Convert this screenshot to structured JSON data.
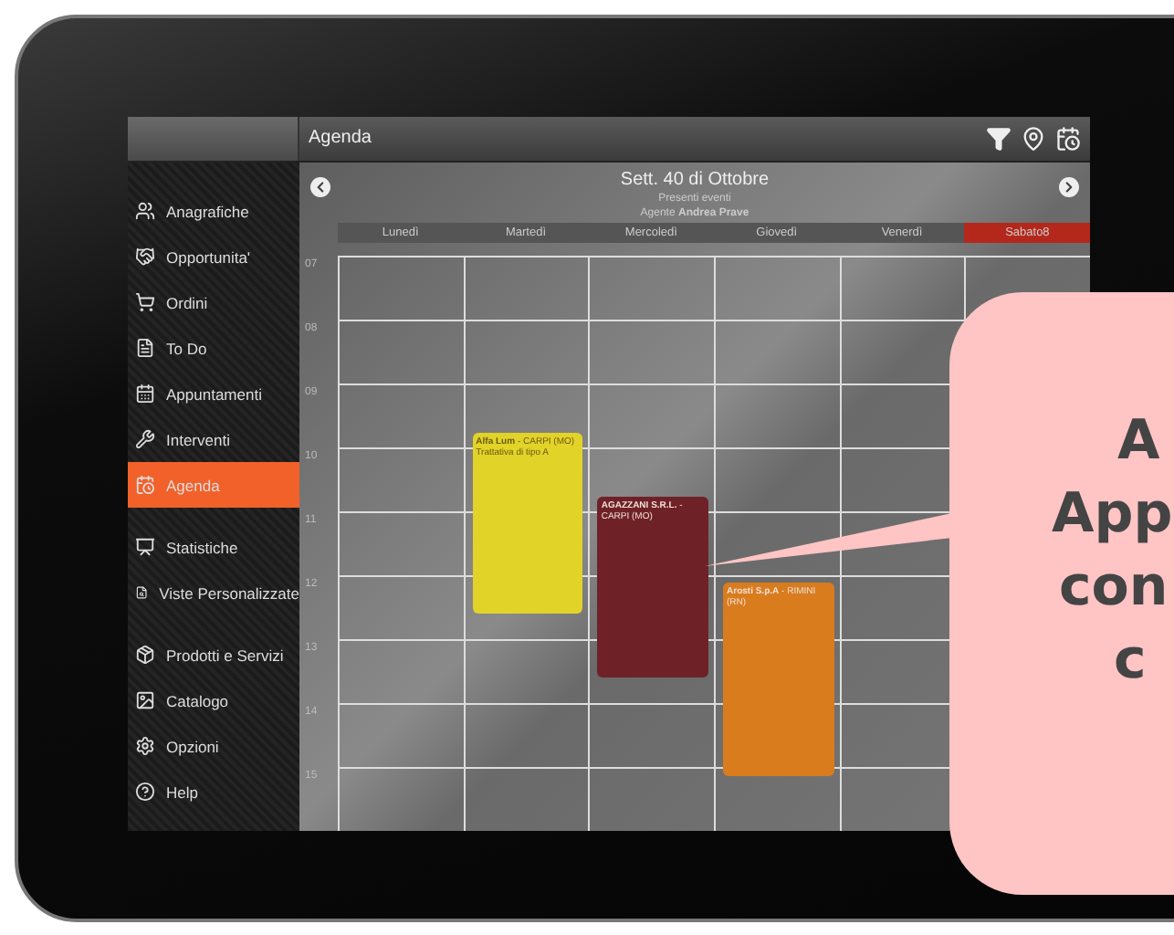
{
  "header": {
    "title": "Agenda"
  },
  "sidebar": {
    "groups": [
      [
        {
          "label": "Anagrafiche",
          "kind": "people",
          "selected": false
        },
        {
          "label": "Opportunita'",
          "kind": "handshake",
          "selected": false
        },
        {
          "label": "Ordini",
          "kind": "cart",
          "selected": false
        },
        {
          "label": "To Do",
          "kind": "todo",
          "selected": false
        },
        {
          "label": "Appuntamenti",
          "kind": "calendar",
          "selected": false
        },
        {
          "label": "Interventi",
          "kind": "tools",
          "selected": false
        },
        {
          "label": "Agenda",
          "kind": "agenda",
          "selected": true
        }
      ],
      [
        {
          "label": "Statistiche",
          "kind": "chart",
          "selected": false
        },
        {
          "label": "Viste Personalizzate",
          "kind": "search",
          "selected": false
        }
      ],
      [
        {
          "label": "Prodotti e Servizi",
          "kind": "box",
          "selected": false
        },
        {
          "label": "Catalogo",
          "kind": "image",
          "selected": false
        },
        {
          "label": "Opzioni",
          "kind": "settings",
          "selected": false
        },
        {
          "label": "Help",
          "kind": "help",
          "selected": false
        }
      ]
    ]
  },
  "calendar": {
    "title": "Sett. 40 di Ottobre",
    "subtitle": "Presenti eventi",
    "agent": "Agente **Andrea Prave**",
    "hours": [
      "07",
      "08",
      "09",
      "10",
      "11",
      "12",
      "13",
      "14",
      "15"
    ],
    "days": [
      {
        "label": "Lunedì",
        "selected": false
      },
      {
        "label": "Martedì",
        "selected": false,
        "events": [
          {
            "text": "**Alfa Lum** - CARPI (MO)",
            "note": "Trattativa di tipo A",
            "color": "#e2d329"
          }
        ]
      },
      {
        "label": "Mercoledì",
        "selected": false,
        "events": [
          {
            "text": "**AGAZZANI S.R.L.** - CARPI (MO)",
            "color": "#6e2228"
          }
        ]
      },
      {
        "label": "Giovedì",
        "selected": false,
        "events": [
          {
            "text": "**Arosti S.p.A** - RIMINI (RN)",
            "color": "#d97c1e"
          }
        ]
      },
      {
        "label": "Venerdì",
        "selected": false
      },
      {
        "label": "Sabato8",
        "selected": true
      }
    ]
  },
  "callout": {
    "lines": [
      "A",
      "App",
      "con",
      "c"
    ]
  }
}
